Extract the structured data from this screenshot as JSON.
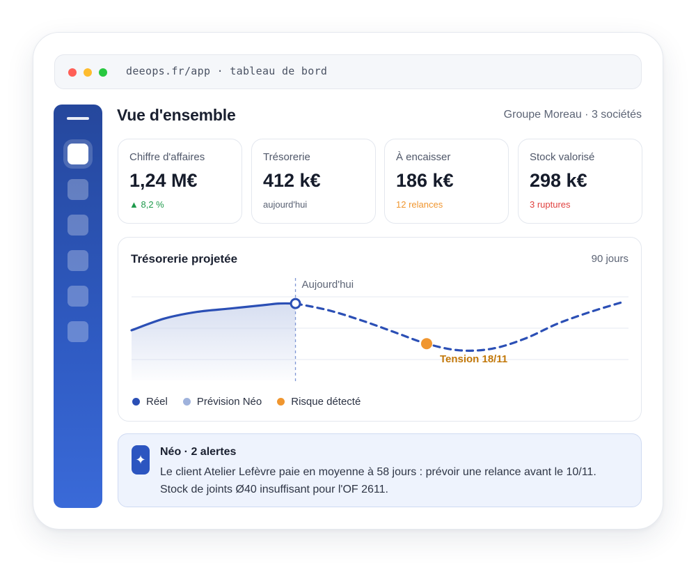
{
  "window": {
    "address": "deeops.fr/app · tableau de bord",
    "dots": [
      "#ff5f57",
      "#febc2e",
      "#28c840"
    ]
  },
  "sidebar": {
    "items": [
      {
        "icon": "home-icon",
        "active": true
      },
      {
        "icon": "nav-icon-2",
        "active": false
      },
      {
        "icon": "nav-icon-3",
        "active": false
      },
      {
        "icon": "nav-icon-4",
        "active": false
      },
      {
        "icon": "nav-icon-5",
        "active": false
      },
      {
        "icon": "nav-icon-6",
        "active": false
      }
    ]
  },
  "header": {
    "title": "Vue d'ensemble",
    "company": "Groupe Moreau · 3 sociétés"
  },
  "kpis": [
    {
      "label": "Chiffre d'affaires",
      "value": "1,24 M€",
      "sub": "▲ 8,2 %",
      "sub_color": "#1f9a4c"
    },
    {
      "label": "Trésorerie",
      "value": "412 k€",
      "sub": "aujourd'hui",
      "sub_color": "#596173"
    },
    {
      "label": "À encaisser",
      "value": "186 k€",
      "sub": "12 relances",
      "sub_color": "#f0962f"
    },
    {
      "label": "Stock valorisé",
      "value": "298 k€",
      "sub": "3 ruptures",
      "sub_color": "#e0413f"
    }
  ],
  "chart": {
    "title": "Trésorerie projetée",
    "range": "90 jours",
    "today_label": "Aujourd'hui",
    "tension_label": "Tension 18/11",
    "legend": [
      {
        "label": "Réel",
        "color": "#2b4fb5"
      },
      {
        "label": "Prévision Néo",
        "color": "#9fb2dc"
      },
      {
        "label": "Risque détecté",
        "color": "#f0962f"
      }
    ]
  },
  "chart_data": {
    "type": "line",
    "title": "Trésorerie projetée",
    "series": [
      {
        "name": "Réel",
        "x": [
          0,
          10,
          20,
          30,
          40,
          45,
          50
        ],
        "y": [
          50,
          57,
          61,
          63,
          65,
          66,
          66
        ]
      },
      {
        "name": "Prévision Néo",
        "x": [
          50,
          60,
          70,
          80,
          90,
          100,
          110,
          120,
          130,
          140,
          150
        ],
        "y": [
          66,
          62,
          56,
          49,
          42,
          38,
          39,
          45,
          54,
          61,
          67
        ]
      }
    ],
    "markers": [
      {
        "label": "Aujourd'hui",
        "x": 50
      },
      {
        "label": "Tension 18/11",
        "x": 90,
        "y": 42
      }
    ],
    "xlim": [
      0,
      152
    ],
    "ylim": [
      20,
      80
    ],
    "grid": true
  },
  "alert": {
    "icon": "sparkle-icon",
    "glyph": "✦",
    "title": "Néo · 2 alertes",
    "body": "Le client Atelier Lefèvre paie en moyenne à 58 jours : prévoir une relance avant le 10/11. Stock de joints Ø40 insuffisant pour l'OF 2611."
  }
}
